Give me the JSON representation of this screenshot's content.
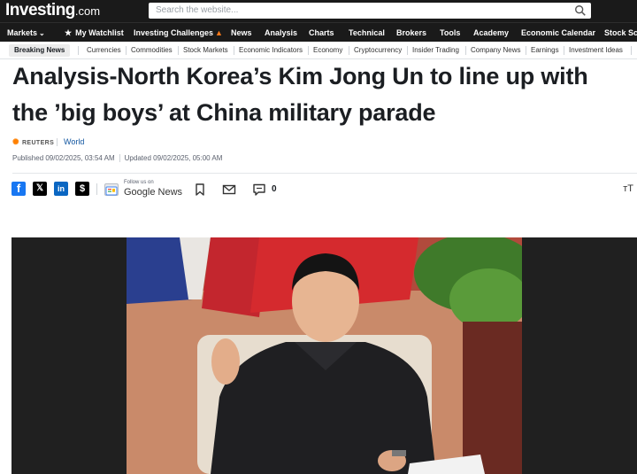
{
  "header": {
    "logo_text": "Investing",
    "logo_suffix": ".com",
    "search_placeholder": "Search the website..."
  },
  "main_nav": [
    {
      "label": "Markets"
    },
    {
      "label": "My Watchlist"
    },
    {
      "label": "Investing Challenges"
    },
    {
      "label": "News"
    },
    {
      "label": "Analysis"
    },
    {
      "label": "Charts"
    },
    {
      "label": "Technical"
    },
    {
      "label": "Brokers"
    },
    {
      "label": "Tools"
    },
    {
      "label": "Academy"
    },
    {
      "label": "Economic Calendar"
    },
    {
      "label": "Stock Scr"
    }
  ],
  "sub_nav": {
    "breaking": "Breaking News",
    "items": [
      "Currencies",
      "Commodities",
      "Stock Markets",
      "Economic Indicators",
      "Economy",
      "Cryptocurrency",
      "Insider Trading",
      "Company News",
      "Earnings",
      "Investment Ideas"
    ]
  },
  "article": {
    "title_line1": "Analysis-North Korea’s Kim Jong Un to line up with",
    "title_line2": "the ’big boys’ at China military parade",
    "source": "REUTERS",
    "category": "World",
    "published": "Published 09/02/2025, 03:54 AM",
    "updated": "Updated 09/02/2025, 05:00 AM",
    "comment_count": "0",
    "follow_small": "Follow us on",
    "follow_big": "Google News",
    "text_size_label": "ᴛT"
  },
  "colors": {
    "header_bg": "#1a1a1a",
    "link_blue": "#1256a0",
    "facebook": "#1877f2",
    "linkedin": "#0a66c2",
    "reuters_orange": "#ff8000"
  }
}
